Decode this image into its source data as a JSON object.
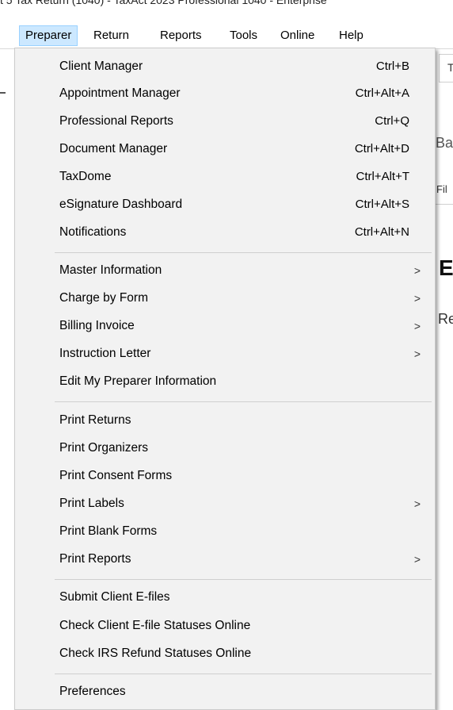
{
  "window": {
    "title": "t 5 Tax Return (1040) - TaxAct 2023 Professional 1040 - Enterprise"
  },
  "menubar": {
    "items": [
      {
        "label": "Preparer",
        "active": true
      },
      {
        "label": "Return"
      },
      {
        "label": "Reports"
      },
      {
        "label": "Tools"
      },
      {
        "label": "Online"
      },
      {
        "label": "Help"
      }
    ]
  },
  "background": {
    "tab_text": "T",
    "ba_text": "Ba",
    "fi_text": "Fil",
    "e_text": "E",
    "re_text": "Re"
  },
  "dropdown": {
    "groups": [
      [
        {
          "label": "Client Manager",
          "shortcut": "Ctrl+B"
        },
        {
          "label": "Appointment Manager",
          "shortcut": "Ctrl+Alt+A"
        },
        {
          "label": "Professional Reports",
          "shortcut": "Ctrl+Q"
        },
        {
          "label": "Document Manager",
          "shortcut": "Ctrl+Alt+D"
        },
        {
          "label": "TaxDome",
          "shortcut": "Ctrl+Alt+T"
        },
        {
          "label": "eSignature Dashboard",
          "shortcut": "Ctrl+Alt+S"
        },
        {
          "label": "Notifications",
          "shortcut": "Ctrl+Alt+N"
        }
      ],
      [
        {
          "label": "Master Information",
          "submenu": true
        },
        {
          "label": "Charge by Form",
          "submenu": true
        },
        {
          "label": "Billing Invoice",
          "submenu": true
        },
        {
          "label": "Instruction Letter",
          "submenu": true
        },
        {
          "label": "Edit My Preparer Information"
        }
      ],
      [
        {
          "label": "Print Returns"
        },
        {
          "label": "Print Organizers"
        },
        {
          "label": "Print Consent Forms"
        },
        {
          "label": "Print Labels",
          "submenu": true
        },
        {
          "label": "Print Blank Forms"
        },
        {
          "label": "Print Reports",
          "submenu": true
        }
      ],
      [
        {
          "label": "Submit Client E-files"
        },
        {
          "label": "Check Client E-file Statuses Online"
        },
        {
          "label": "Check IRS Refund Statuses Online"
        }
      ],
      [
        {
          "label": "Preferences"
        }
      ]
    ],
    "submenu_glyph": ">"
  },
  "colors": {
    "menu_bg": "#f2f2f2",
    "active_menubar_bg": "#cce8ff",
    "active_menubar_border": "#99d1ff",
    "separator": "#cfcfcf"
  }
}
